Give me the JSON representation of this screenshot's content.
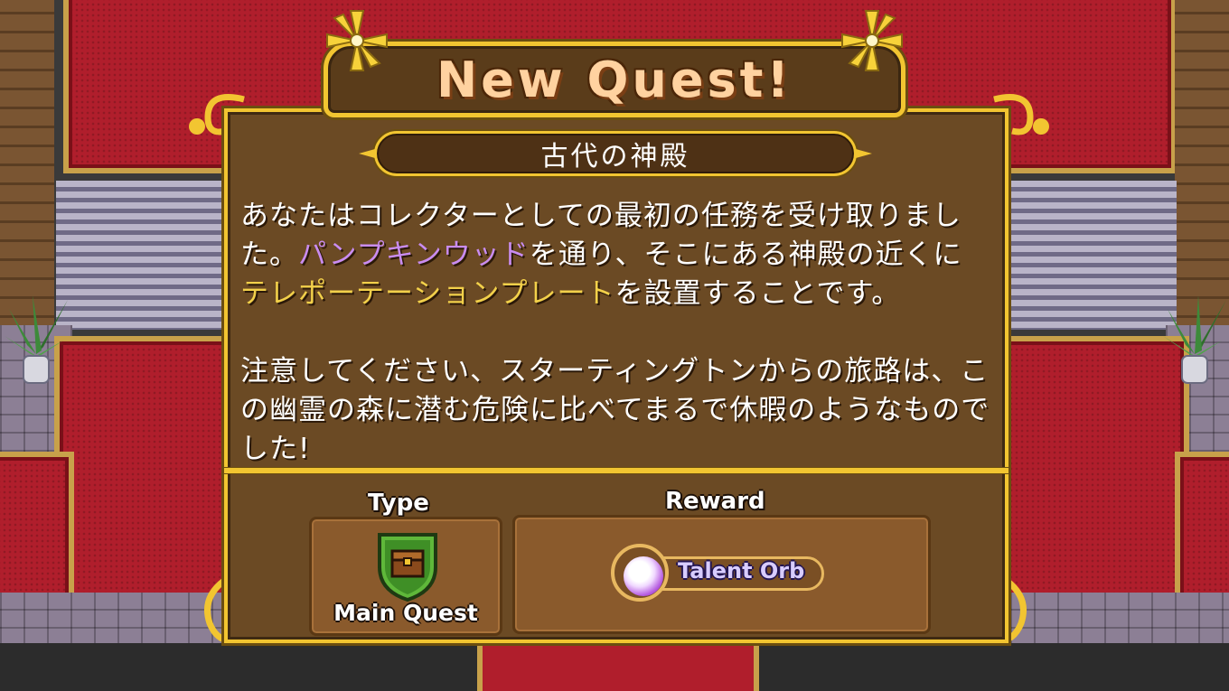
{
  "dialog": {
    "title": "New Quest!",
    "quest_name": "古代の神殿",
    "description": {
      "p1_part1": "あなたはコレクターとしての最初の任務を受け取りました。",
      "p1_highlight1": "パンプキンウッド",
      "p1_part2": "を通り、そこにある神殿の近くに",
      "p1_highlight2": "テレポーテーションプレート",
      "p1_part3": "を設置することです。",
      "p2": "注意してください、スターティングトンからの旅路は、この幽霊の森に潜む危険に比べてまるで休暇のようなものでした!"
    },
    "type_label": "Type",
    "type_value": "Main Quest",
    "type_icon": "treasure-chest-shield-icon",
    "reward_label": "Reward",
    "reward_value": "Talent Orb",
    "reward_icon": "talent-orb-icon"
  },
  "colors": {
    "gold_border": "#f2c531",
    "panel_brown": "#6b4a24",
    "highlight_purple": "#c98cf0",
    "highlight_yellow": "#f2d04a",
    "carpet_red": "#b01e2c"
  }
}
